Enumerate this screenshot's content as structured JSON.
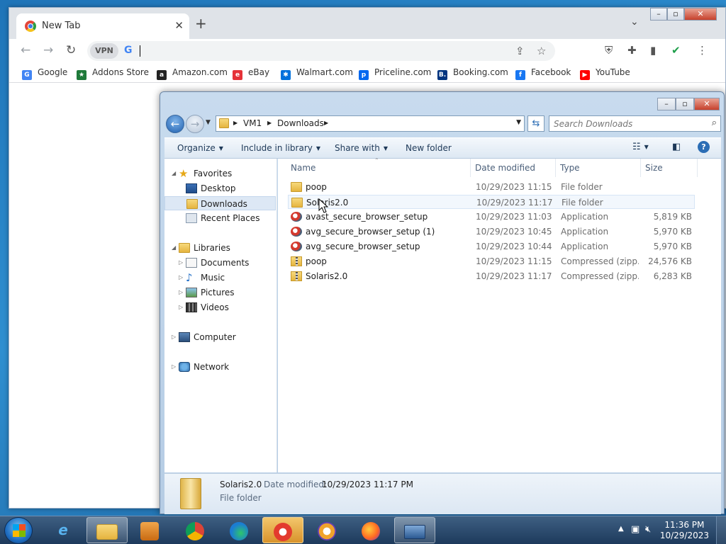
{
  "chrome": {
    "tab_title": "New Tab",
    "tab_close": "✕",
    "new_tab": "+",
    "vpn_label": "VPN",
    "omnibox_value": "",
    "bookmarks": [
      {
        "label": "Google",
        "icon": "google-icon",
        "color": "#4285f4",
        "glyph": "G"
      },
      {
        "label": "Addons Store",
        "icon": "addons-store-icon",
        "color": "#1f7a3a",
        "glyph": "★"
      },
      {
        "label": "Amazon.com",
        "icon": "amazon-icon",
        "color": "#222222",
        "glyph": "a"
      },
      {
        "label": "eBay",
        "icon": "ebay-icon",
        "color": "#e53238",
        "glyph": "e"
      },
      {
        "label": "Walmart.com",
        "icon": "walmart-icon",
        "color": "#0071dc",
        "glyph": "✱"
      },
      {
        "label": "Priceline.com",
        "icon": "priceline-icon",
        "color": "#0068ef",
        "glyph": "p"
      },
      {
        "label": "Booking.com",
        "icon": "booking-icon",
        "color": "#003580",
        "glyph": "B."
      },
      {
        "label": "Facebook",
        "icon": "facebook-icon",
        "color": "#1877f2",
        "glyph": "f"
      },
      {
        "label": "YouTube",
        "icon": "youtube-icon",
        "color": "#ff0000",
        "glyph": "▶"
      }
    ]
  },
  "explorer": {
    "breadcrumb": [
      "VM1",
      "Downloads"
    ],
    "search_placeholder": "Search Downloads",
    "commands": {
      "organize": "Organize",
      "include": "Include in library",
      "share": "Share with",
      "new_folder": "New folder"
    },
    "nav": {
      "favorites": "Favorites",
      "desktop": "Desktop",
      "downloads": "Downloads",
      "recent": "Recent Places",
      "libraries": "Libraries",
      "documents": "Documents",
      "music": "Music",
      "pictures": "Pictures",
      "videos": "Videos",
      "computer": "Computer",
      "network": "Network"
    },
    "columns": {
      "name": "Name",
      "date": "Date modified",
      "type": "Type",
      "size": "Size"
    },
    "files": [
      {
        "name": "poop",
        "date": "10/29/2023 11:15 ...",
        "type": "File folder",
        "size": "",
        "kind": "folder"
      },
      {
        "name": "Solaris2.0",
        "date": "10/29/2023 11:17 ...",
        "type": "File folder",
        "size": "",
        "kind": "folder"
      },
      {
        "name": "avast_secure_browser_setup",
        "date": "10/29/2023 11:03 ...",
        "type": "Application",
        "size": "5,819 KB",
        "kind": "app"
      },
      {
        "name": "avg_secure_browser_setup (1)",
        "date": "10/29/2023 10:45 ...",
        "type": "Application",
        "size": "5,970 KB",
        "kind": "app"
      },
      {
        "name": "avg_secure_browser_setup",
        "date": "10/29/2023 10:44 ...",
        "type": "Application",
        "size": "5,970 KB",
        "kind": "app"
      },
      {
        "name": "poop",
        "date": "10/29/2023 11:15 ...",
        "type": "Compressed (zipp...",
        "size": "24,576 KB",
        "kind": "zip"
      },
      {
        "name": "Solaris2.0",
        "date": "10/29/2023 11:17 ...",
        "type": "Compressed (zipp...",
        "size": "6,283 KB",
        "kind": "zip"
      }
    ],
    "details": {
      "name": "Solaris2.0",
      "date_label": "Date modified:",
      "date_value": "10/29/2023 11:17 PM",
      "type": "File folder"
    }
  },
  "taskbar": {
    "time": "11:36 PM",
    "date": "10/29/2023"
  }
}
